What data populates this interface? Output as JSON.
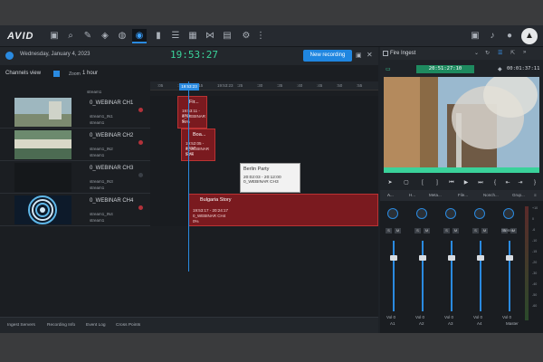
{
  "app": {
    "logo": "AVID"
  },
  "toolbar": {
    "icons": [
      "folder-icon",
      "search-icon",
      "edit-icon",
      "collections-icon",
      "globe-icon",
      "capture-icon",
      "bookmark-icon",
      "list-icon",
      "grid-icon",
      "share-icon",
      "dashboard-icon",
      "settings-icon",
      "more-icon"
    ],
    "right_icons": [
      "layout-icon",
      "bell-icon",
      "user-icon",
      "avid-icon"
    ]
  },
  "recording": {
    "date": "Wednesday, January 4, 2023",
    "current_time": "19:53:27",
    "new_button": "New recording",
    "channels_view": "Channels view",
    "zoom_label": "Zoom",
    "zoom_value": "1 hour",
    "ruler_ticks": [
      ":05",
      ":10",
      ":15",
      "19:53:23",
      ":25",
      ":30",
      ":35",
      ":40",
      ":45",
      ":50",
      ":55"
    ],
    "stream_tag": "stream1",
    "channels": [
      {
        "name": "0_WEBINAR CH1",
        "sub1": "stream1_IN1",
        "sub2": "stream1",
        "clip": {
          "title": "Fir...",
          "time": "19:53:11 - 19:5",
          "source": "0_WEBINAR C",
          "pct": "36%"
        }
      },
      {
        "name": "0_WEBINAR CH2",
        "sub1": "stream1_IN2",
        "sub2": "stream1",
        "clip": {
          "title": "Boa...",
          "time": "19:52:05 - 19:57",
          "source": "0_WEBINAR CH2",
          "pct": "24%"
        }
      },
      {
        "name": "0_WEBINAR CH3",
        "sub1": "stream1_IN3",
        "sub2": "stream1"
      },
      {
        "name": "0_WEBINAR CH4",
        "sub1": "stream1_IN4",
        "sub2": "stream1",
        "clip": {
          "title": "Bulgaria Story",
          "time": "19:53:17 - 20:24:17",
          "source": "0_WEBINAR CH4",
          "pct": "0%"
        }
      }
    ],
    "tooltip": {
      "title": "Berlin Party",
      "time": "20:02:03 - 20:12:00",
      "source": "0_WEBINAR CH3"
    },
    "bottom_tabs": [
      "Ingest Servers",
      "Recording Info",
      "Event Log",
      "Cross Points"
    ]
  },
  "monitor": {
    "title": "Fire Ingest",
    "timecode": "20:51:27:10",
    "duration": "00:01:37:11",
    "mix_tabs": [
      "A...",
      "H...",
      "Meta...",
      "File...",
      "Nonch...",
      "Grup..."
    ],
    "channels": [
      "A1",
      "A2",
      "A3",
      "A4",
      "Master"
    ],
    "stereo_label": "Stereo",
    "fader_vals": [
      "Vol",
      "0"
    ],
    "db_scale": [
      "+10",
      "0",
      "-6",
      "-10",
      "-15",
      "-20",
      "-30",
      "-40",
      "-50",
      "-60"
    ]
  }
}
